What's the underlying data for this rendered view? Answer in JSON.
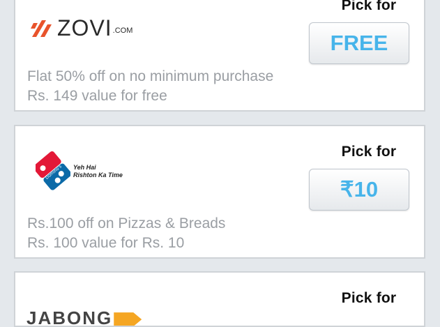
{
  "offers": [
    {
      "brand": "ZOVI",
      "brand_suffix": ".COM",
      "pick_label": "Pick for",
      "price": "FREE",
      "desc_line1": "Flat 50% off on no minimum purchase",
      "desc_line2": "Rs. 149 value for free"
    },
    {
      "brand": "Domino's Pizza",
      "tagline_line1": "Yeh Hai",
      "tagline_line2": "Rishton Ka Time",
      "pick_label": "Pick for",
      "price": "₹10",
      "desc_line1": "Rs.100 off on Pizzas & Breads",
      "desc_line2": "Rs. 100 value for Rs. 10"
    },
    {
      "brand": "JABONG",
      "pick_label": "Pick for"
    }
  ],
  "colors": {
    "price_text": "#47b4ea",
    "zovi_orange": "#e8532b",
    "dominos_blue": "#0b6aa8",
    "dominos_red": "#e31837"
  }
}
